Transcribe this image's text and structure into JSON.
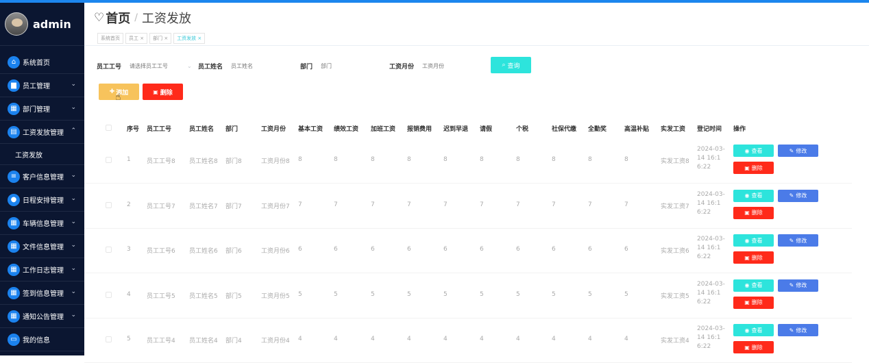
{
  "sidebar": {
    "brand": "admin",
    "items": [
      {
        "label": "系统首页",
        "icon": "home-icon",
        "glyph": "⌂",
        "chevron": false
      },
      {
        "label": "员工管理",
        "icon": "folder-icon",
        "glyph": "▆",
        "chevron": true
      },
      {
        "label": "部门管理",
        "icon": "grid-icon",
        "glyph": "▦",
        "chevron": true
      },
      {
        "label": "工资发放管理",
        "icon": "document-icon",
        "glyph": "▤",
        "chevron": true,
        "expanded": true
      },
      {
        "label": "客户信息管理",
        "icon": "list-icon",
        "glyph": "≡",
        "chevron": true
      },
      {
        "label": "日程安排管理",
        "icon": "location-icon",
        "glyph": "●",
        "chevron": true
      },
      {
        "label": "车辆信息管理",
        "icon": "grid-icon",
        "glyph": "▦",
        "chevron": true
      },
      {
        "label": "文件信息管理",
        "icon": "grid-icon",
        "glyph": "▦",
        "chevron": true
      },
      {
        "label": "工作日志管理",
        "icon": "grid-icon",
        "glyph": "▦",
        "chevron": true
      },
      {
        "label": "签到信息管理",
        "icon": "grid-icon",
        "glyph": "▦",
        "chevron": true
      },
      {
        "label": "通知公告管理",
        "icon": "grid-icon",
        "glyph": "▦",
        "chevron": true
      },
      {
        "label": "我的信息",
        "icon": "card-icon",
        "glyph": "▭",
        "chevron": false
      }
    ],
    "submenu_label": "工资发放"
  },
  "header": {
    "home": "首页",
    "separator": "/",
    "title": "工资发放"
  },
  "tabs": [
    {
      "label": "系统首页",
      "active": false
    },
    {
      "label": "员工 ×",
      "active": false
    },
    {
      "label": "部门 ×",
      "active": false
    },
    {
      "label": "工资发放 ×",
      "active": true
    }
  ],
  "search": {
    "emp_no_label": "员工工号",
    "emp_no_placeholder": "请选择员工工号",
    "emp_name_label": "员工姓名",
    "emp_name_placeholder": "员工姓名",
    "dept_label": "部门",
    "dept_placeholder": "部门",
    "month_label": "工资月份",
    "month_placeholder": "工资月份",
    "query_label": "查询"
  },
  "actions": {
    "add_label": "添加",
    "delete_label": "删除"
  },
  "table": {
    "headers": [
      "序号",
      "员工工号",
      "员工姓名",
      "部门",
      "工资月份",
      "基本工资",
      "绩效工资",
      "加班工资",
      "报销费用",
      "迟到早退",
      "请假",
      "个税",
      "社保代缴",
      "全勤奖",
      "高温补贴",
      "实发工资",
      "登记时间",
      "操作"
    ],
    "rows": [
      {
        "cells": [
          "1",
          "员工工号8",
          "员工姓名8",
          "部门8",
          "工资月份8",
          "8",
          "8",
          "8",
          "8",
          "8",
          "8",
          "8",
          "8",
          "8",
          "8",
          "实发工资8"
        ],
        "date": "2024-03-14 16:16:22"
      },
      {
        "cells": [
          "2",
          "员工工号7",
          "员工姓名7",
          "部门7",
          "工资月份7",
          "7",
          "7",
          "7",
          "7",
          "7",
          "7",
          "7",
          "7",
          "7",
          "7",
          "实发工资7"
        ],
        "date": "2024-03-14 16:16:22"
      },
      {
        "cells": [
          "3",
          "员工工号6",
          "员工姓名6",
          "部门6",
          "工资月份6",
          "6",
          "6",
          "6",
          "6",
          "6",
          "6",
          "6",
          "6",
          "6",
          "6",
          "实发工资6"
        ],
        "date": "2024-03-14 16:16:22"
      },
      {
        "cells": [
          "4",
          "员工工号5",
          "员工姓名5",
          "部门5",
          "工资月份5",
          "5",
          "5",
          "5",
          "5",
          "5",
          "5",
          "5",
          "5",
          "5",
          "5",
          "实发工资5"
        ],
        "date": "2024-03-14 16:16:22"
      },
      {
        "cells": [
          "5",
          "员工工号4",
          "员工姓名4",
          "部门4",
          "工资月份4",
          "4",
          "4",
          "4",
          "4",
          "4",
          "4",
          "4",
          "4",
          "4",
          "4",
          "实发工资4"
        ],
        "date": "2024-03-14 16:16:22"
      }
    ],
    "view_label": "查看",
    "edit_label": "修改",
    "delete_label": "删除"
  },
  "colors": {
    "sidebar_bg": "#0b1631",
    "accent": "#1b82ee",
    "query": "#2de4dc",
    "add": "#f7c35c",
    "danger": "#ff2a1a",
    "edit": "#4b7be8"
  }
}
